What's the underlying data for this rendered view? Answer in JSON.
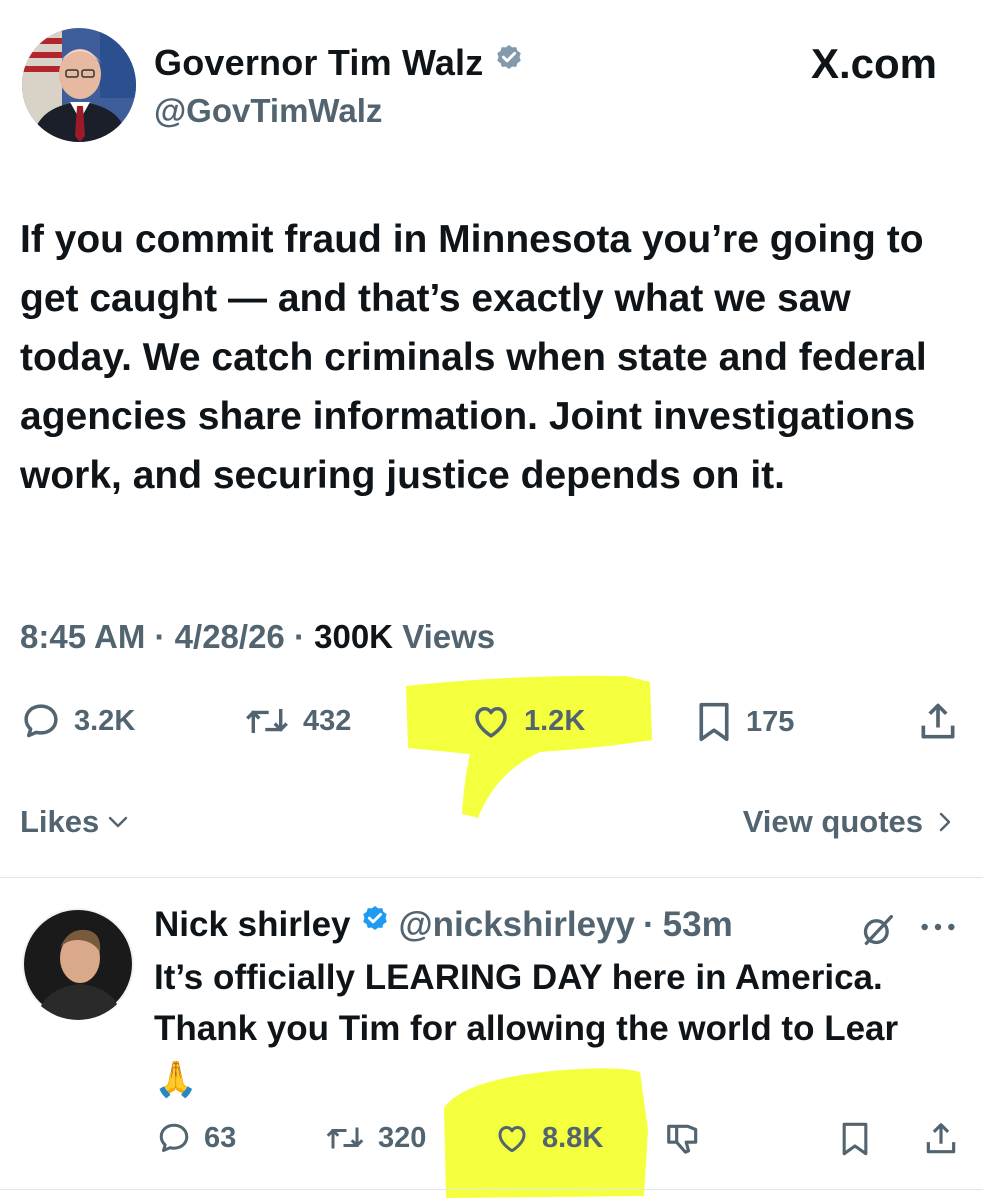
{
  "main_tweet": {
    "author_name": "Governor Tim Walz",
    "handle": "@GovTimWalz",
    "site_label": "X.com",
    "text": "If you commit fraud in Minnesota you’re going to get caught — and that’s exactly what we saw today. We catch criminals when state and federal agencies share information. Joint investigations work, and securing justice depends on it.",
    "time": "8:45 AM",
    "separator": "·",
    "date": "4/28/26",
    "views_count": "300K",
    "views_label": "Views",
    "replies": "3.2K",
    "reposts": "432",
    "likes": "1.2K",
    "bookmarks": "175",
    "likes_link": "Likes",
    "quotes_link": "View quotes"
  },
  "reply_tweet": {
    "author_name": "Nick shirley",
    "handle": "@nickshirleyy",
    "separator": "·",
    "age": "53m",
    "text": "It’s officially LEARING DAY here in America. Thank you Tim for allowing the world to Lear",
    "emoji": "🙏",
    "replies": "63",
    "reposts": "320",
    "likes": "8.8K"
  },
  "colors": {
    "text": "#0f1419",
    "muted": "#536471",
    "verified": "#1d9bf0",
    "highlighter": "#f3ff2e"
  }
}
